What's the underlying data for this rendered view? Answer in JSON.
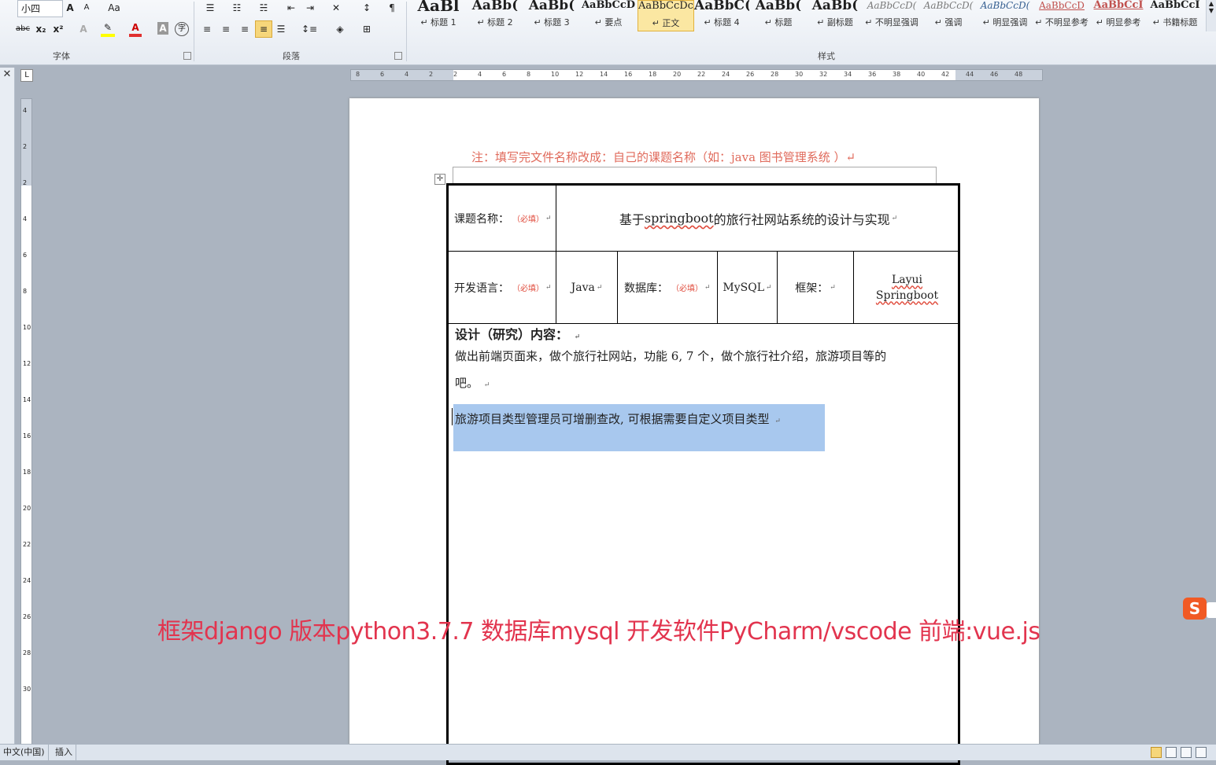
{
  "ribbon": {
    "font_size_value": "小四",
    "font_group_label": "字体",
    "paragraph_group_label": "段落",
    "styles_group_label": "样式",
    "styles": [
      {
        "sample": "AaBl",
        "name": "标题 1",
        "cls": "big"
      },
      {
        "sample": "AaBb(",
        "name": "标题 2",
        "cls": "med"
      },
      {
        "sample": "AaBb(",
        "name": "标题 3",
        "cls": "med"
      },
      {
        "sample": "AaBbCcD",
        "name": "要点",
        "cls": "bk"
      },
      {
        "sample": "AaBbCcDc",
        "name": "正文",
        "cls": "sm"
      },
      {
        "sample": "AaBbC(",
        "name": "标题 4",
        "cls": "med"
      },
      {
        "sample": "AaBb(",
        "name": "标题",
        "cls": "med"
      },
      {
        "sample": "AaBb(",
        "name": "副标题",
        "cls": "med"
      },
      {
        "sample": "AaBbCcD(",
        "name": "不明显强调",
        "cls": "it"
      },
      {
        "sample": "AaBbCcD(",
        "name": "强调",
        "cls": "it"
      },
      {
        "sample": "AaBbCcD(",
        "name": "明显强调",
        "cls": "blue"
      },
      {
        "sample": "AaBbCcD",
        "name": "不明显参考",
        "cls": "red"
      },
      {
        "sample": "AaBbCcI",
        "name": "明显参考",
        "cls": "redb"
      },
      {
        "sample": "AaBbCcI",
        "name": "书籍标题",
        "cls": "bk"
      }
    ],
    "font_buttons": [
      "A",
      "A",
      "Aa",
      "abc",
      "x₂",
      "x²",
      "A",
      "A",
      "A"
    ],
    "selected_style": "正文"
  },
  "document": {
    "note": "注：填写完文件名称改成：自己的课题名称（如：java 图书管理系统  ）↵",
    "row1": {
      "label": "课题名称：",
      "required": "（必填）",
      "value_prefix": "基于 ",
      "value_word": "springboot",
      "value_suffix": " 的旅行社网站系统的设计与实现"
    },
    "row2": {
      "lang_label": "开发语言：",
      "lang_required": "（必填）",
      "lang_value": "Java",
      "db_label": "数据库：",
      "db_required": "（必填）",
      "db_value": "MySQL",
      "fw_label": "框架：",
      "fw_value1": "Layui",
      "fw_value2": "Springboot"
    },
    "content_title": "设计（研究）内容：",
    "content_line1": "做出前端页面来，做个旅行社网站，功能 6, 7 个，做个旅行社介绍，旅游项目等的",
    "content_line2": "吧。",
    "selected_text": "旅游项目类型管理员可增删查改, 可根据需要自定义项目类型",
    "para_mark": "↵"
  },
  "overlay_caption": "框架django 版本python3.7.7 数据库mysql  开发软件PyCharm/vscode 前端:vue.js",
  "status": {
    "language": "中文(中国)",
    "mode": "插入"
  },
  "ruler_labels": [
    "8",
    "6",
    "4",
    "2",
    "2",
    "4",
    "6",
    "8",
    "10",
    "12",
    "14",
    "16",
    "18",
    "20",
    "22",
    "24",
    "26",
    "28",
    "30",
    "32",
    "34",
    "36",
    "38",
    "40",
    "42",
    "44",
    "46",
    "48"
  ],
  "vruler_labels": [
    "4",
    "2",
    "2",
    "4",
    "6",
    "8",
    "10",
    "12",
    "14",
    "16",
    "18",
    "20",
    "22",
    "24",
    "26",
    "28",
    "30"
  ]
}
